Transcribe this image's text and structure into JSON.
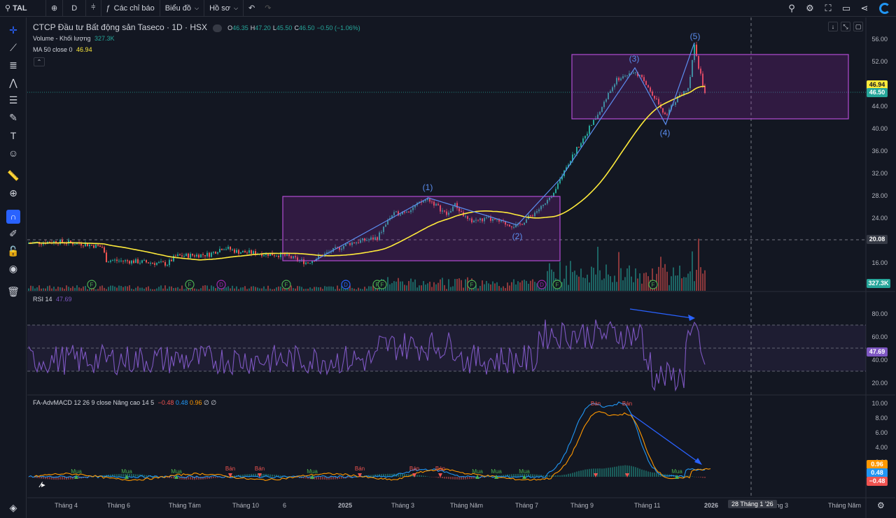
{
  "toolbar": {
    "symbol": "TAL",
    "interval": "D",
    "indicators_label": "Các chỉ báo",
    "chart_type_label": "Biểu đồ",
    "profile_label": "Hồ sơ"
  },
  "legend": {
    "title": "CTCP Đầu tư Bất động sản Taseco · 1D · HSX",
    "o_label": "O",
    "o_value": "46.35",
    "h_label": "H",
    "h_value": "47.20",
    "l_label": "L",
    "l_value": "45.50",
    "c_label": "C",
    "c_value": "46.50",
    "change": "−0.50 (−1.06%)",
    "volume_label": "Volume - Khối lượng",
    "volume_value": "327.3K",
    "ma_label": "MA 50 close 0",
    "ma_value": "46.94"
  },
  "rsi": {
    "label": "RSI 14",
    "value": "47.69"
  },
  "macd": {
    "label": "FA-AdvMACD 12 26 9 close Nâng cao 14 5",
    "v1": "−0.48",
    "v2": "0.48",
    "v3": "0.96",
    "v4": "∅",
    "v5": "∅",
    "buy_label": "Mua",
    "sell_label": "Bán"
  },
  "price_axis": [
    "56.00",
    "52.00",
    "48.00",
    "44.00",
    "40.00",
    "36.00",
    "32.00",
    "28.00",
    "24.00",
    "20.00",
    "16.00"
  ],
  "price_tags": {
    "ma": "46.94",
    "close": "46.50",
    "line": "20.08",
    "volume": "327.3K"
  },
  "rsi_axis": [
    "80.00",
    "60.00",
    "40.00",
    "20.00"
  ],
  "rsi_tag": "47.69",
  "macd_axis": [
    "10.00",
    "8.00",
    "6.00",
    "4.00",
    "2.00",
    "−2.00"
  ],
  "macd_tags": {
    "a": "0.96",
    "b": "0.48",
    "c": "−0.48"
  },
  "time_axis": [
    "Tháng 4",
    "Tháng 6",
    "Tháng Tám",
    "Tháng 10",
    "6",
    "2025",
    "Tháng 3",
    "Tháng Năm",
    "Tháng 7",
    "Tháng 9",
    "Tháng 11",
    "2026",
    "Tháng 3",
    "Tháng Năm"
  ],
  "crosshair_date": "28 Tháng 1 '26",
  "waves": [
    "(1)",
    "(2)",
    "(3)",
    "(4)",
    "(5)"
  ],
  "markers": {
    "f": "F",
    "d": "D"
  },
  "colors": {
    "up": "#26a69a",
    "down": "#ef5350",
    "ma": "#ffeb3b",
    "box": "#9c27b0",
    "wave": "#5b8def",
    "rsi": "#7e57c2"
  }
}
